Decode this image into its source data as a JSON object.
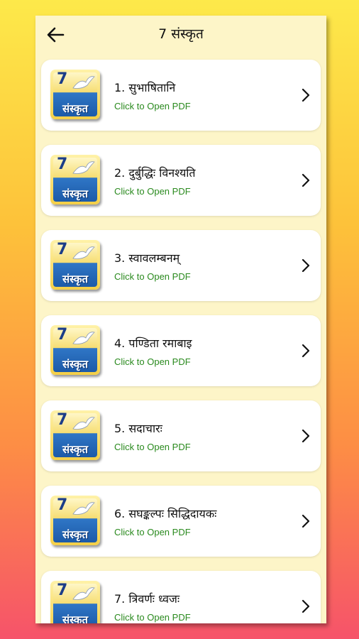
{
  "header": {
    "title": "7 संस्कृत",
    "back_icon": "arrow-left-icon"
  },
  "thumbnail": {
    "number": "7",
    "word": "संस्कृत"
  },
  "lessons": [
    {
      "title": "1. सुभाषितानि",
      "subtitle": "Click to Open PDF"
    },
    {
      "title": "2. दुर्बुद्धिः विनश्यति",
      "subtitle": "Click to Open PDF"
    },
    {
      "title": "3. स्वावलम्बनम्",
      "subtitle": "Click to Open PDF"
    },
    {
      "title": "4. पण्डिता रमाबाइ",
      "subtitle": "Click to Open PDF"
    },
    {
      "title": "5. सदाचारः",
      "subtitle": "Click to Open PDF"
    },
    {
      "title": "6. सघङ्कल्पः सिद्धिदायकः",
      "subtitle": "Click to Open PDF"
    },
    {
      "title": "7. त्रिवर्णः ध्वजः",
      "subtitle": "Click to Open PDF"
    }
  ],
  "colors": {
    "accent_green": "#2a8a1e",
    "panel_bg": "#fdf5c8"
  }
}
